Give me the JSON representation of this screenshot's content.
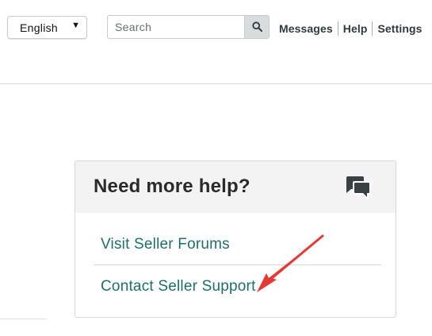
{
  "header": {
    "language_selector": {
      "value": "English",
      "caret": "▼"
    },
    "search": {
      "placeholder": "Search",
      "button_icon": "search-icon"
    },
    "links": [
      {
        "label": "Messages"
      },
      {
        "label": "Help"
      },
      {
        "label": "Settings"
      }
    ]
  },
  "help_card": {
    "title": "Need more help?",
    "icon": "chat-bubbles-icon",
    "links": [
      {
        "label": "Visit Seller Forums"
      },
      {
        "label": "Contact Seller Support"
      }
    ]
  },
  "annotation": {
    "type": "arrow",
    "color": "#e53935",
    "points_to": "Contact Seller Support"
  },
  "colors": {
    "link_teal": "#1e6f6c",
    "header_bg": "#f3f3f3",
    "border": "#d5d9d9",
    "search_button_bg": "#d8dcdc"
  }
}
